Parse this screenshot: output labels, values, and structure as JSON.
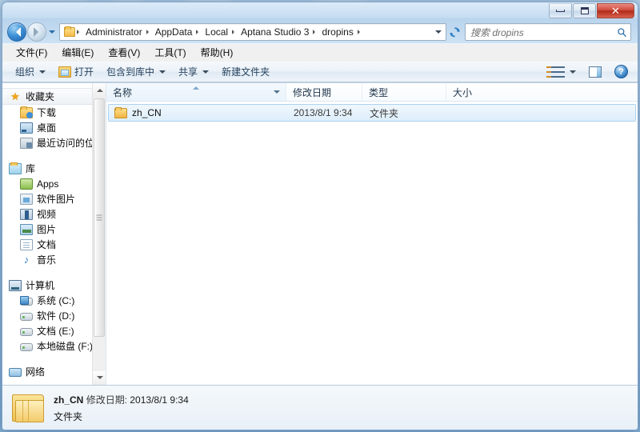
{
  "window": {
    "controls": {
      "minimize_label": "最小化",
      "maximize_label": "最大化",
      "close_label": "✕"
    }
  },
  "address": {
    "back_label": "后退",
    "forward_label": "前进",
    "recent_label": "最近浏览的位置",
    "crumbs": [
      "Administrator",
      "AppData",
      "Local",
      "Aptana Studio 3",
      "dropins"
    ],
    "dropdown_label": "地址栏下拉",
    "refresh_label": "刷新"
  },
  "search": {
    "placeholder": "搜索 dropins",
    "icon": "search-icon"
  },
  "menubar": {
    "items": [
      {
        "label": "文件(F)"
      },
      {
        "label": "编辑(E)"
      },
      {
        "label": "查看(V)"
      },
      {
        "label": "工具(T)"
      },
      {
        "label": "帮助(H)"
      }
    ]
  },
  "toolbar": {
    "organize_label": "组织",
    "open_label": "打开",
    "include_library_label": "包含到库中",
    "share_label": "共享",
    "new_folder_label": "新建文件夹",
    "view_label": "更改视图",
    "preview_label": "显示预览窗格",
    "help_label": "?"
  },
  "sidebar": {
    "groups": [
      {
        "head": {
          "label": "收藏夹",
          "icon": "star-icon",
          "selected": true
        },
        "items": [
          {
            "label": "下载",
            "icon": "download-folder-icon"
          },
          {
            "label": "桌面",
            "icon": "desktop-icon"
          },
          {
            "label": "最近访问的位置",
            "icon": "recent-places-icon"
          }
        ]
      },
      {
        "head": {
          "label": "库",
          "icon": "library-icon",
          "selected": false
        },
        "items": [
          {
            "label": "Apps",
            "icon": "apps-icon"
          },
          {
            "label": "软件图片",
            "icon": "software-pictures-icon"
          },
          {
            "label": "视频",
            "icon": "video-icon"
          },
          {
            "label": "图片",
            "icon": "pictures-icon"
          },
          {
            "label": "文档",
            "icon": "documents-icon"
          },
          {
            "label": "音乐",
            "icon": "music-icon"
          }
        ]
      },
      {
        "head": {
          "label": "计算机",
          "icon": "computer-icon",
          "selected": false
        },
        "items": [
          {
            "label": "系统 (C:)",
            "icon": "system-drive-icon"
          },
          {
            "label": "软件 (D:)",
            "icon": "drive-icon"
          },
          {
            "label": "文档 (E:)",
            "icon": "drive-icon"
          },
          {
            "label": "本地磁盘 (F:)",
            "icon": "drive-icon"
          }
        ]
      },
      {
        "head": {
          "label": "网络",
          "icon": "network-icon",
          "selected": false
        },
        "items": []
      }
    ]
  },
  "filelist": {
    "columns": [
      {
        "label": "名称",
        "sorted": true
      },
      {
        "label": "修改日期",
        "sorted": false
      },
      {
        "label": "类型",
        "sorted": false
      },
      {
        "label": "大小",
        "sorted": false
      }
    ],
    "rows": [
      {
        "name": "zh_CN",
        "date": "2013/8/1 9:34",
        "type": "文件夹",
        "size": "",
        "icon": "folder-icon",
        "selected": true
      }
    ]
  },
  "details": {
    "name": "zh_CN",
    "date_label": "修改日期:",
    "date_value": "2013/8/1 9:34",
    "type": "文件夹",
    "icon": "folder-large-icon"
  }
}
